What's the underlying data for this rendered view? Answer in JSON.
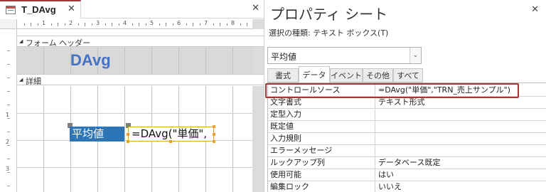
{
  "document": {
    "tab_title": "T_DAvg",
    "tab_close": "✕",
    "pane_close": "✕"
  },
  "ruler": {
    "numbers": [
      "1",
      "2",
      "3",
      "4",
      "5",
      "6",
      "7",
      "8"
    ],
    "left_numbers": [
      "1",
      "2",
      "3"
    ]
  },
  "form": {
    "header_section": "フォーム ヘッダー",
    "header_title": "DAvg",
    "detail_section": "詳細",
    "label_control": "平均値",
    "textbox_control": "=DAvg(\"単価\","
  },
  "property_sheet": {
    "title": "プロパティ シート",
    "close": "✕",
    "selection_type": "選択の種類: テキスト ボックス(T)",
    "selected_object": "平均値",
    "tabs": [
      {
        "label": "書式",
        "active": false
      },
      {
        "label": "データ",
        "active": true
      },
      {
        "label": "イベント",
        "active": false
      },
      {
        "label": "その他",
        "active": false
      },
      {
        "label": "すべて",
        "active": false
      }
    ],
    "rows": [
      {
        "name": "コントロールソース",
        "value": "=DAvg(\"単価\",\"TRN_売上サンプル\")"
      },
      {
        "name": "文字書式",
        "value": "テキスト形式"
      },
      {
        "name": "定型入力",
        "value": ""
      },
      {
        "name": "既定値",
        "value": ""
      },
      {
        "name": "入力規則",
        "value": ""
      },
      {
        "name": "エラーメッセージ",
        "value": ""
      },
      {
        "name": "ルックアップ列",
        "value": "データベース既定"
      },
      {
        "name": "使用可能",
        "value": "はい"
      },
      {
        "name": "編集ロック",
        "value": "いいえ"
      }
    ]
  },
  "colors": {
    "accent": "#a4373a",
    "label_bg": "#2e75b6",
    "header_title": "#4472c4",
    "selection_border": "#e8a030"
  },
  "icons": {
    "doc_tab": "form-icon",
    "combo": "chevron-down-icon"
  }
}
